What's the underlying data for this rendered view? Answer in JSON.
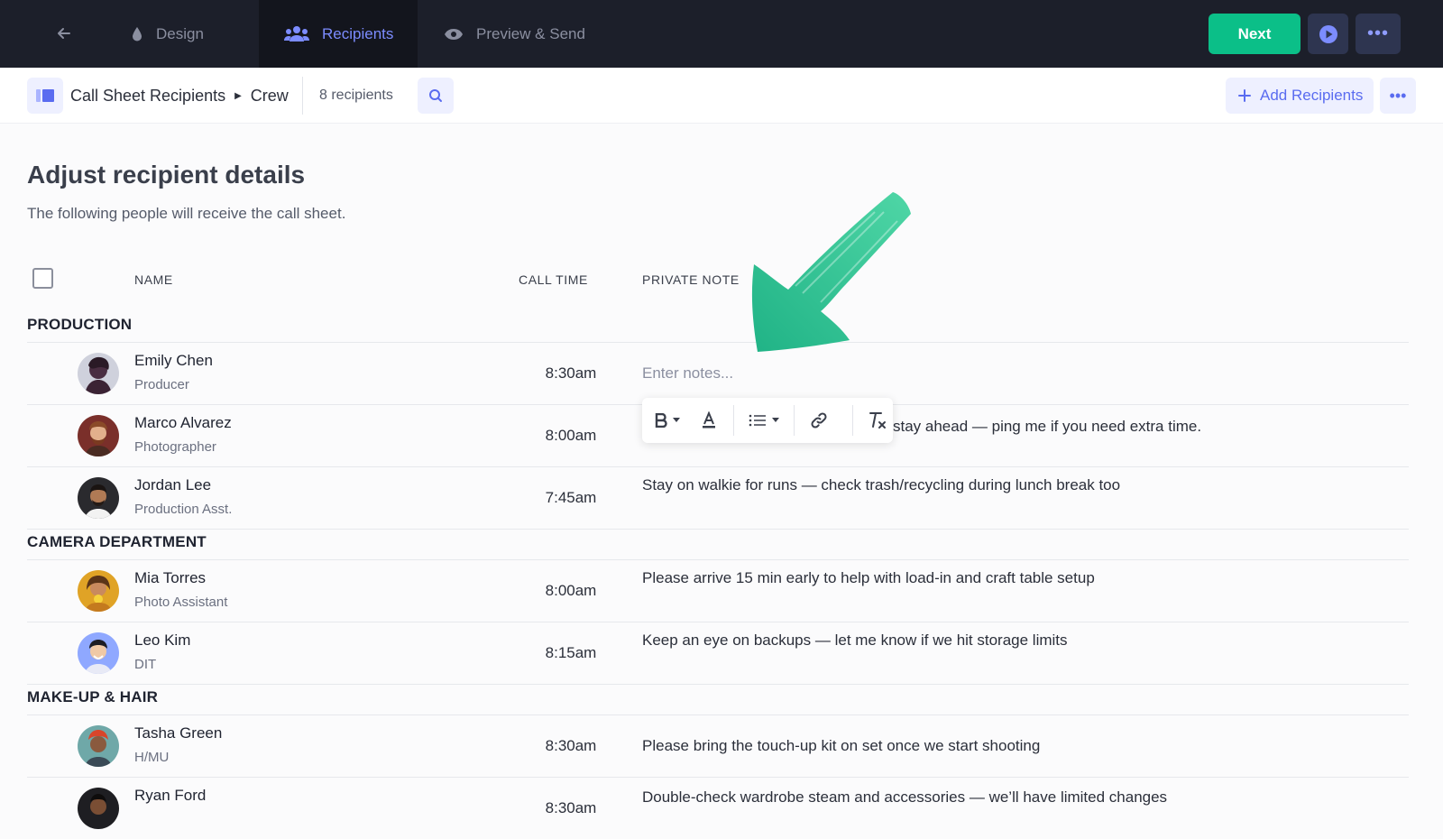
{
  "topbar": {
    "back_icon": "arrow-left-icon",
    "tabs": [
      {
        "label": "Design",
        "icon": "droplet-icon"
      },
      {
        "label": "Recipients",
        "icon": "users-icon",
        "active": true
      },
      {
        "label": "Preview & Send",
        "icon": "eye-icon"
      }
    ],
    "next_label": "Next",
    "play_icon": "play-circle-icon",
    "more_icon": "more-horizontal-icon"
  },
  "subbar": {
    "list_name": "Call Sheet Recipients",
    "group_name": "Crew",
    "count": "8 recipients",
    "add_label": "Add Recipients"
  },
  "content": {
    "heading": "Adjust recipient details",
    "subheading": "The following people will receive the call sheet."
  },
  "table": {
    "columns": [
      "NAME",
      "CALL TIME",
      "PRIVATE NOTE"
    ],
    "groups": [
      {
        "title": "PRODUCTION",
        "rows": [
          {
            "name": "Emily Chen",
            "role": "Producer",
            "time": "8:30am",
            "note": "Enter notes...",
            "note_placeholder": true
          },
          {
            "name": "Marco Alvarez",
            "role": "Photographer",
            "time": "8:00am",
            "note": "stay ahead — ping me if you need extra time."
          },
          {
            "name": "Jordan Lee",
            "role": "Production Asst.",
            "time": "7:45am",
            "note": "Stay on walkie for runs — check trash/recycling during lunch break too"
          }
        ]
      },
      {
        "title": "CAMERA DEPARTMENT",
        "rows": [
          {
            "name": "Mia Torres",
            "role": "Photo Assistant",
            "time": "8:00am",
            "note": "Please arrive 15 min early to help with load-in and craft table setup"
          },
          {
            "name": "Leo Kim",
            "role": "DIT",
            "time": "8:15am",
            "note": "Keep an eye on backups — let me know if we hit storage limits"
          }
        ]
      },
      {
        "title": "MAKE-UP & HAIR",
        "rows": [
          {
            "name": "Tasha Green",
            "role": "H/MU",
            "time": "8:30am",
            "note": "Please bring the touch-up kit on set once we start shooting"
          },
          {
            "name": "Ryan Ford",
            "role": "",
            "time": "8:30am",
            "note": "Double-check wardrobe steam and accessories — we’ll have limited changes"
          }
        ]
      }
    ]
  },
  "format_toolbar": {
    "buttons": [
      "bold-icon",
      "text-color-icon",
      "list-icon",
      "link-icon",
      "clear-format-icon"
    ]
  },
  "colors": {
    "topbar_bg": "#1c1f2a",
    "accent": "#5a6cf0",
    "next_button": "#0bbf88",
    "annotation_arrow": "#3ecf9e"
  }
}
